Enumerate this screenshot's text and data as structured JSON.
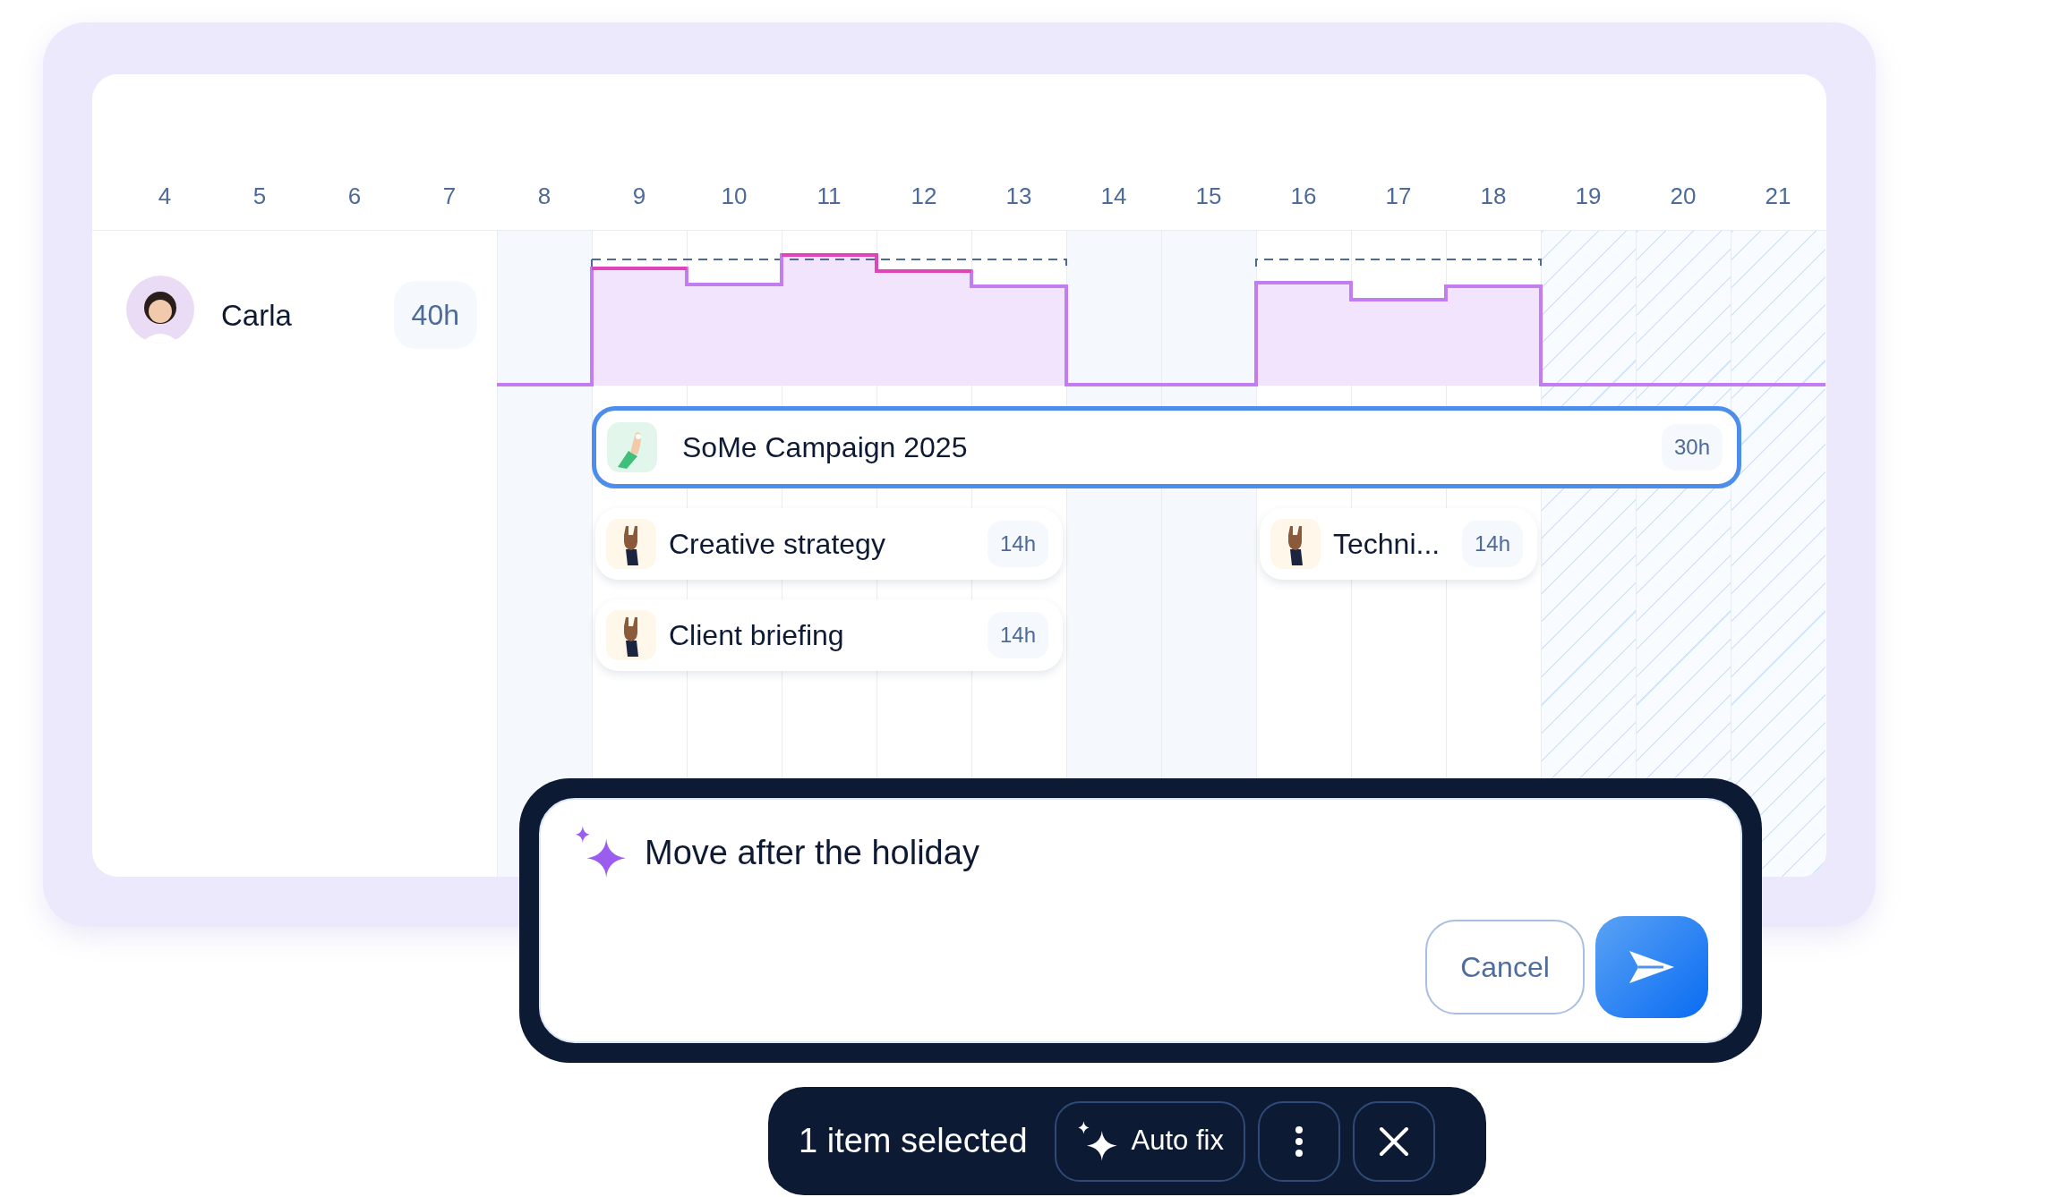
{
  "days": [
    {
      "label": "4"
    },
    {
      "label": "5"
    },
    {
      "label": "6"
    },
    {
      "label": "7"
    },
    {
      "label": "8",
      "kind": "off"
    },
    {
      "label": "9",
      "kind": "workday"
    },
    {
      "label": "10",
      "kind": "workday"
    },
    {
      "label": "11",
      "kind": "workday"
    },
    {
      "label": "12",
      "kind": "workday"
    },
    {
      "label": "13",
      "kind": "workday"
    },
    {
      "label": "14",
      "kind": "off"
    },
    {
      "label": "15",
      "kind": "off"
    },
    {
      "label": "16",
      "kind": "workday"
    },
    {
      "label": "17",
      "kind": "workday"
    },
    {
      "label": "18",
      "kind": "workday"
    },
    {
      "label": "19",
      "kind": "holiday"
    },
    {
      "label": "20",
      "kind": "holiday"
    },
    {
      "label": "21",
      "kind": "holiday"
    }
  ],
  "person": {
    "name": "Carla",
    "hours": "40h"
  },
  "tasks": [
    {
      "title": "SoMe Campaign 2025",
      "hours": "30h",
      "selected": true
    },
    {
      "title": "Creative strategy",
      "hours": "14h",
      "selected": false
    },
    {
      "title": "Techni...",
      "hours": "14h",
      "selected": false
    },
    {
      "title": "Client briefing",
      "hours": "14h",
      "selected": false
    }
  ],
  "prompt": {
    "value": "Move after the holiday",
    "cancel": "Cancel"
  },
  "selection_bar": {
    "count": "1 item selected",
    "auto_fix": "Auto fix"
  }
}
